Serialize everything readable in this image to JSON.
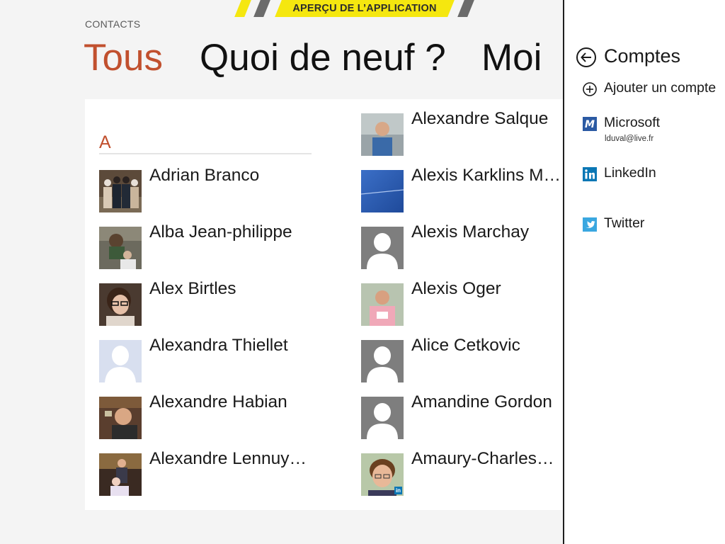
{
  "banner": {
    "text": "APERÇU DE L’APPLICATION"
  },
  "app_label": "CONTACTS",
  "pivots": [
    "Tous",
    "Quoi de neuf ?",
    "Moi"
  ],
  "letter": "A",
  "contacts_col1": [
    {
      "name": "Adrian Branco",
      "avatar": "photo"
    },
    {
      "name": "Alba Jean-philippe",
      "avatar": "photo"
    },
    {
      "name": "Alex Birtles",
      "avatar": "photo"
    },
    {
      "name": "Alexandra Thiellet",
      "avatar": "facebook-silhouette"
    },
    {
      "name": "Alexandre Habian",
      "avatar": "photo"
    },
    {
      "name": "Alexandre Lennuy…",
      "avatar": "photo"
    }
  ],
  "contacts_col2": [
    {
      "name": "Alexandre Salque",
      "avatar": "photo"
    },
    {
      "name": "Alexis Karklins Ma…",
      "avatar": "blue-image"
    },
    {
      "name": "Alexis Marchay",
      "avatar": "default-silhouette"
    },
    {
      "name": "Alexis Oger",
      "avatar": "photo"
    },
    {
      "name": "Alice Cetkovic",
      "avatar": "default-silhouette"
    },
    {
      "name": "Amandine Gordon",
      "avatar": "default-silhouette"
    },
    {
      "name": "Amaury-Charles…",
      "avatar": "photo-linkedin"
    }
  ],
  "accounts_pane": {
    "title": "Comptes",
    "add": "Ajouter un compte",
    "items": [
      {
        "label": "Microsoft",
        "sub": "lduval@live.fr",
        "icon": "microsoft-icon"
      },
      {
        "label": "LinkedIn",
        "icon": "linkedin-icon"
      },
      {
        "label": "Twitter",
        "icon": "twitter-icon"
      }
    ]
  },
  "colors": {
    "accent": "#c1502e",
    "banner": "#f5e70f",
    "linkedin": "#0a77b5",
    "twitter": "#3aa7e0",
    "microsoft": "#2b5aa3"
  }
}
